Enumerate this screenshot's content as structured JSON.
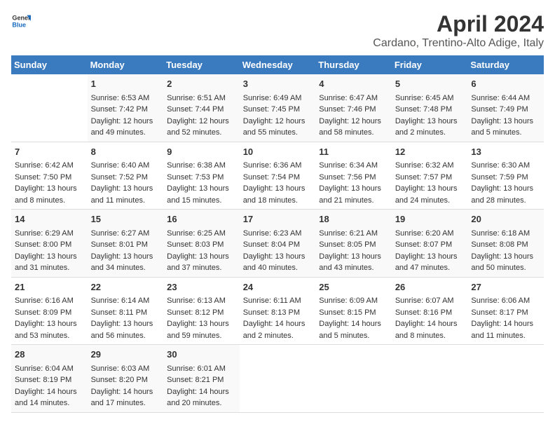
{
  "header": {
    "logo_line1": "General",
    "logo_line2": "Blue",
    "title": "April 2024",
    "subtitle": "Cardano, Trentino-Alto Adige, Italy"
  },
  "days_of_week": [
    "Sunday",
    "Monday",
    "Tuesday",
    "Wednesday",
    "Thursday",
    "Friday",
    "Saturday"
  ],
  "weeks": [
    [
      {
        "day": "",
        "sunrise": "",
        "sunset": "",
        "daylight": ""
      },
      {
        "day": "1",
        "sunrise": "Sunrise: 6:53 AM",
        "sunset": "Sunset: 7:42 PM",
        "daylight": "Daylight: 12 hours and 49 minutes."
      },
      {
        "day": "2",
        "sunrise": "Sunrise: 6:51 AM",
        "sunset": "Sunset: 7:44 PM",
        "daylight": "Daylight: 12 hours and 52 minutes."
      },
      {
        "day": "3",
        "sunrise": "Sunrise: 6:49 AM",
        "sunset": "Sunset: 7:45 PM",
        "daylight": "Daylight: 12 hours and 55 minutes."
      },
      {
        "day": "4",
        "sunrise": "Sunrise: 6:47 AM",
        "sunset": "Sunset: 7:46 PM",
        "daylight": "Daylight: 12 hours and 58 minutes."
      },
      {
        "day": "5",
        "sunrise": "Sunrise: 6:45 AM",
        "sunset": "Sunset: 7:48 PM",
        "daylight": "Daylight: 13 hours and 2 minutes."
      },
      {
        "day": "6",
        "sunrise": "Sunrise: 6:44 AM",
        "sunset": "Sunset: 7:49 PM",
        "daylight": "Daylight: 13 hours and 5 minutes."
      }
    ],
    [
      {
        "day": "7",
        "sunrise": "Sunrise: 6:42 AM",
        "sunset": "Sunset: 7:50 PM",
        "daylight": "Daylight: 13 hours and 8 minutes."
      },
      {
        "day": "8",
        "sunrise": "Sunrise: 6:40 AM",
        "sunset": "Sunset: 7:52 PM",
        "daylight": "Daylight: 13 hours and 11 minutes."
      },
      {
        "day": "9",
        "sunrise": "Sunrise: 6:38 AM",
        "sunset": "Sunset: 7:53 PM",
        "daylight": "Daylight: 13 hours and 15 minutes."
      },
      {
        "day": "10",
        "sunrise": "Sunrise: 6:36 AM",
        "sunset": "Sunset: 7:54 PM",
        "daylight": "Daylight: 13 hours and 18 minutes."
      },
      {
        "day": "11",
        "sunrise": "Sunrise: 6:34 AM",
        "sunset": "Sunset: 7:56 PM",
        "daylight": "Daylight: 13 hours and 21 minutes."
      },
      {
        "day": "12",
        "sunrise": "Sunrise: 6:32 AM",
        "sunset": "Sunset: 7:57 PM",
        "daylight": "Daylight: 13 hours and 24 minutes."
      },
      {
        "day": "13",
        "sunrise": "Sunrise: 6:30 AM",
        "sunset": "Sunset: 7:59 PM",
        "daylight": "Daylight: 13 hours and 28 minutes."
      }
    ],
    [
      {
        "day": "14",
        "sunrise": "Sunrise: 6:29 AM",
        "sunset": "Sunset: 8:00 PM",
        "daylight": "Daylight: 13 hours and 31 minutes."
      },
      {
        "day": "15",
        "sunrise": "Sunrise: 6:27 AM",
        "sunset": "Sunset: 8:01 PM",
        "daylight": "Daylight: 13 hours and 34 minutes."
      },
      {
        "day": "16",
        "sunrise": "Sunrise: 6:25 AM",
        "sunset": "Sunset: 8:03 PM",
        "daylight": "Daylight: 13 hours and 37 minutes."
      },
      {
        "day": "17",
        "sunrise": "Sunrise: 6:23 AM",
        "sunset": "Sunset: 8:04 PM",
        "daylight": "Daylight: 13 hours and 40 minutes."
      },
      {
        "day": "18",
        "sunrise": "Sunrise: 6:21 AM",
        "sunset": "Sunset: 8:05 PM",
        "daylight": "Daylight: 13 hours and 43 minutes."
      },
      {
        "day": "19",
        "sunrise": "Sunrise: 6:20 AM",
        "sunset": "Sunset: 8:07 PM",
        "daylight": "Daylight: 13 hours and 47 minutes."
      },
      {
        "day": "20",
        "sunrise": "Sunrise: 6:18 AM",
        "sunset": "Sunset: 8:08 PM",
        "daylight": "Daylight: 13 hours and 50 minutes."
      }
    ],
    [
      {
        "day": "21",
        "sunrise": "Sunrise: 6:16 AM",
        "sunset": "Sunset: 8:09 PM",
        "daylight": "Daylight: 13 hours and 53 minutes."
      },
      {
        "day": "22",
        "sunrise": "Sunrise: 6:14 AM",
        "sunset": "Sunset: 8:11 PM",
        "daylight": "Daylight: 13 hours and 56 minutes."
      },
      {
        "day": "23",
        "sunrise": "Sunrise: 6:13 AM",
        "sunset": "Sunset: 8:12 PM",
        "daylight": "Daylight: 13 hours and 59 minutes."
      },
      {
        "day": "24",
        "sunrise": "Sunrise: 6:11 AM",
        "sunset": "Sunset: 8:13 PM",
        "daylight": "Daylight: 14 hours and 2 minutes."
      },
      {
        "day": "25",
        "sunrise": "Sunrise: 6:09 AM",
        "sunset": "Sunset: 8:15 PM",
        "daylight": "Daylight: 14 hours and 5 minutes."
      },
      {
        "day": "26",
        "sunrise": "Sunrise: 6:07 AM",
        "sunset": "Sunset: 8:16 PM",
        "daylight": "Daylight: 14 hours and 8 minutes."
      },
      {
        "day": "27",
        "sunrise": "Sunrise: 6:06 AM",
        "sunset": "Sunset: 8:17 PM",
        "daylight": "Daylight: 14 hours and 11 minutes."
      }
    ],
    [
      {
        "day": "28",
        "sunrise": "Sunrise: 6:04 AM",
        "sunset": "Sunset: 8:19 PM",
        "daylight": "Daylight: 14 hours and 14 minutes."
      },
      {
        "day": "29",
        "sunrise": "Sunrise: 6:03 AM",
        "sunset": "Sunset: 8:20 PM",
        "daylight": "Daylight: 14 hours and 17 minutes."
      },
      {
        "day": "30",
        "sunrise": "Sunrise: 6:01 AM",
        "sunset": "Sunset: 8:21 PM",
        "daylight": "Daylight: 14 hours and 20 minutes."
      },
      {
        "day": "",
        "sunrise": "",
        "sunset": "",
        "daylight": ""
      },
      {
        "day": "",
        "sunrise": "",
        "sunset": "",
        "daylight": ""
      },
      {
        "day": "",
        "sunrise": "",
        "sunset": "",
        "daylight": ""
      },
      {
        "day": "",
        "sunrise": "",
        "sunset": "",
        "daylight": ""
      }
    ]
  ]
}
